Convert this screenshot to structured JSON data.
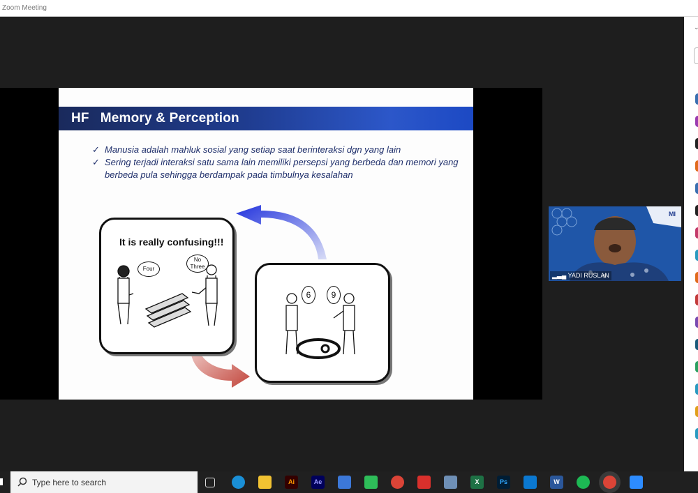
{
  "window": {
    "title": "Zoom Meeting"
  },
  "slide": {
    "prefix": "HF",
    "title": "Memory &  Perception",
    "bullets": [
      "Manusia adalah mahluk sosial  yang setiap saat berinteraksi dgn yang lain",
      "Sering terjadi interaksi  satu sama lain memiliki persepsi yang berbeda  dan memori yang berbeda pula sehingga berdampak pada timbulnya kesalahan"
    ],
    "panel1": {
      "caption": "It is really confusing!!!",
      "left_bubble": "Four",
      "right_bubble_line1": "No",
      "right_bubble_line2": "Three"
    },
    "panel2": {
      "left_bubble": "6",
      "right_bubble": "9"
    }
  },
  "participant": {
    "name": "YADI RUSLAN"
  },
  "taskbar": {
    "search_placeholder": "Type here to search",
    "apps": [
      "task-view",
      "edge",
      "file-explorer",
      "illustrator",
      "after-effects",
      "store",
      "phone",
      "chrome",
      "acrobat",
      "network",
      "excel",
      "photoshop",
      "vscode",
      "word",
      "spotify",
      "chrome-active",
      "zoom"
    ],
    "labels": {
      "illustrator": "Ai",
      "after_effects": "Ae",
      "photoshop": "Ps",
      "excel": "X",
      "word": "W"
    }
  },
  "sidebar_colors": [
    "#3a6fb0",
    "#9b3bb0",
    "#222222",
    "#e06a1c",
    "#3a6fb0",
    "#222222",
    "#c33a6a",
    "#2a9ac0",
    "#e06a1c",
    "#c33a3a",
    "#7a4ab0",
    "#1a5a7a",
    "#2aa060",
    "#2a9ac0",
    "#e0a01c",
    "#2a9ac0"
  ]
}
